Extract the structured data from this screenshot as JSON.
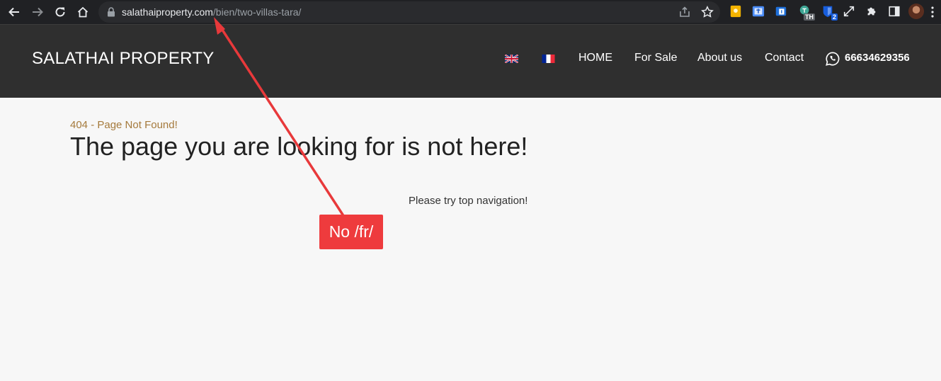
{
  "browser": {
    "url_host": "salathaiproperty.com",
    "url_path": "/bien/two-villas-tara/",
    "extensions": [
      {
        "name": "keep-icon",
        "color": "#f4b400",
        "badge": ""
      },
      {
        "name": "translate-page-icon",
        "color": "#4a8cf7",
        "badge": ""
      },
      {
        "name": "tab-counter-icon",
        "color": "#1e6fd9",
        "badge": ""
      },
      {
        "name": "language-th-icon",
        "color": "#3fa796",
        "badge": "TH"
      },
      {
        "name": "bitwarden-icon",
        "color": "#175ddc",
        "badge": "2"
      }
    ]
  },
  "site": {
    "brand": "SALATHAI PROPERTY",
    "flags": [
      "english-flag",
      "french-flag"
    ],
    "nav": {
      "home": "HOME",
      "for_sale": "For Sale",
      "about": "About us",
      "contact": "Contact"
    },
    "phone": "66634629356"
  },
  "content": {
    "error_code": "404 - Page Not Found!",
    "title": "The page you are looking for is not here!",
    "hint": "Please try top navigation!"
  },
  "annotation": {
    "label": "No /fr/",
    "color": "#ee3b3d"
  }
}
